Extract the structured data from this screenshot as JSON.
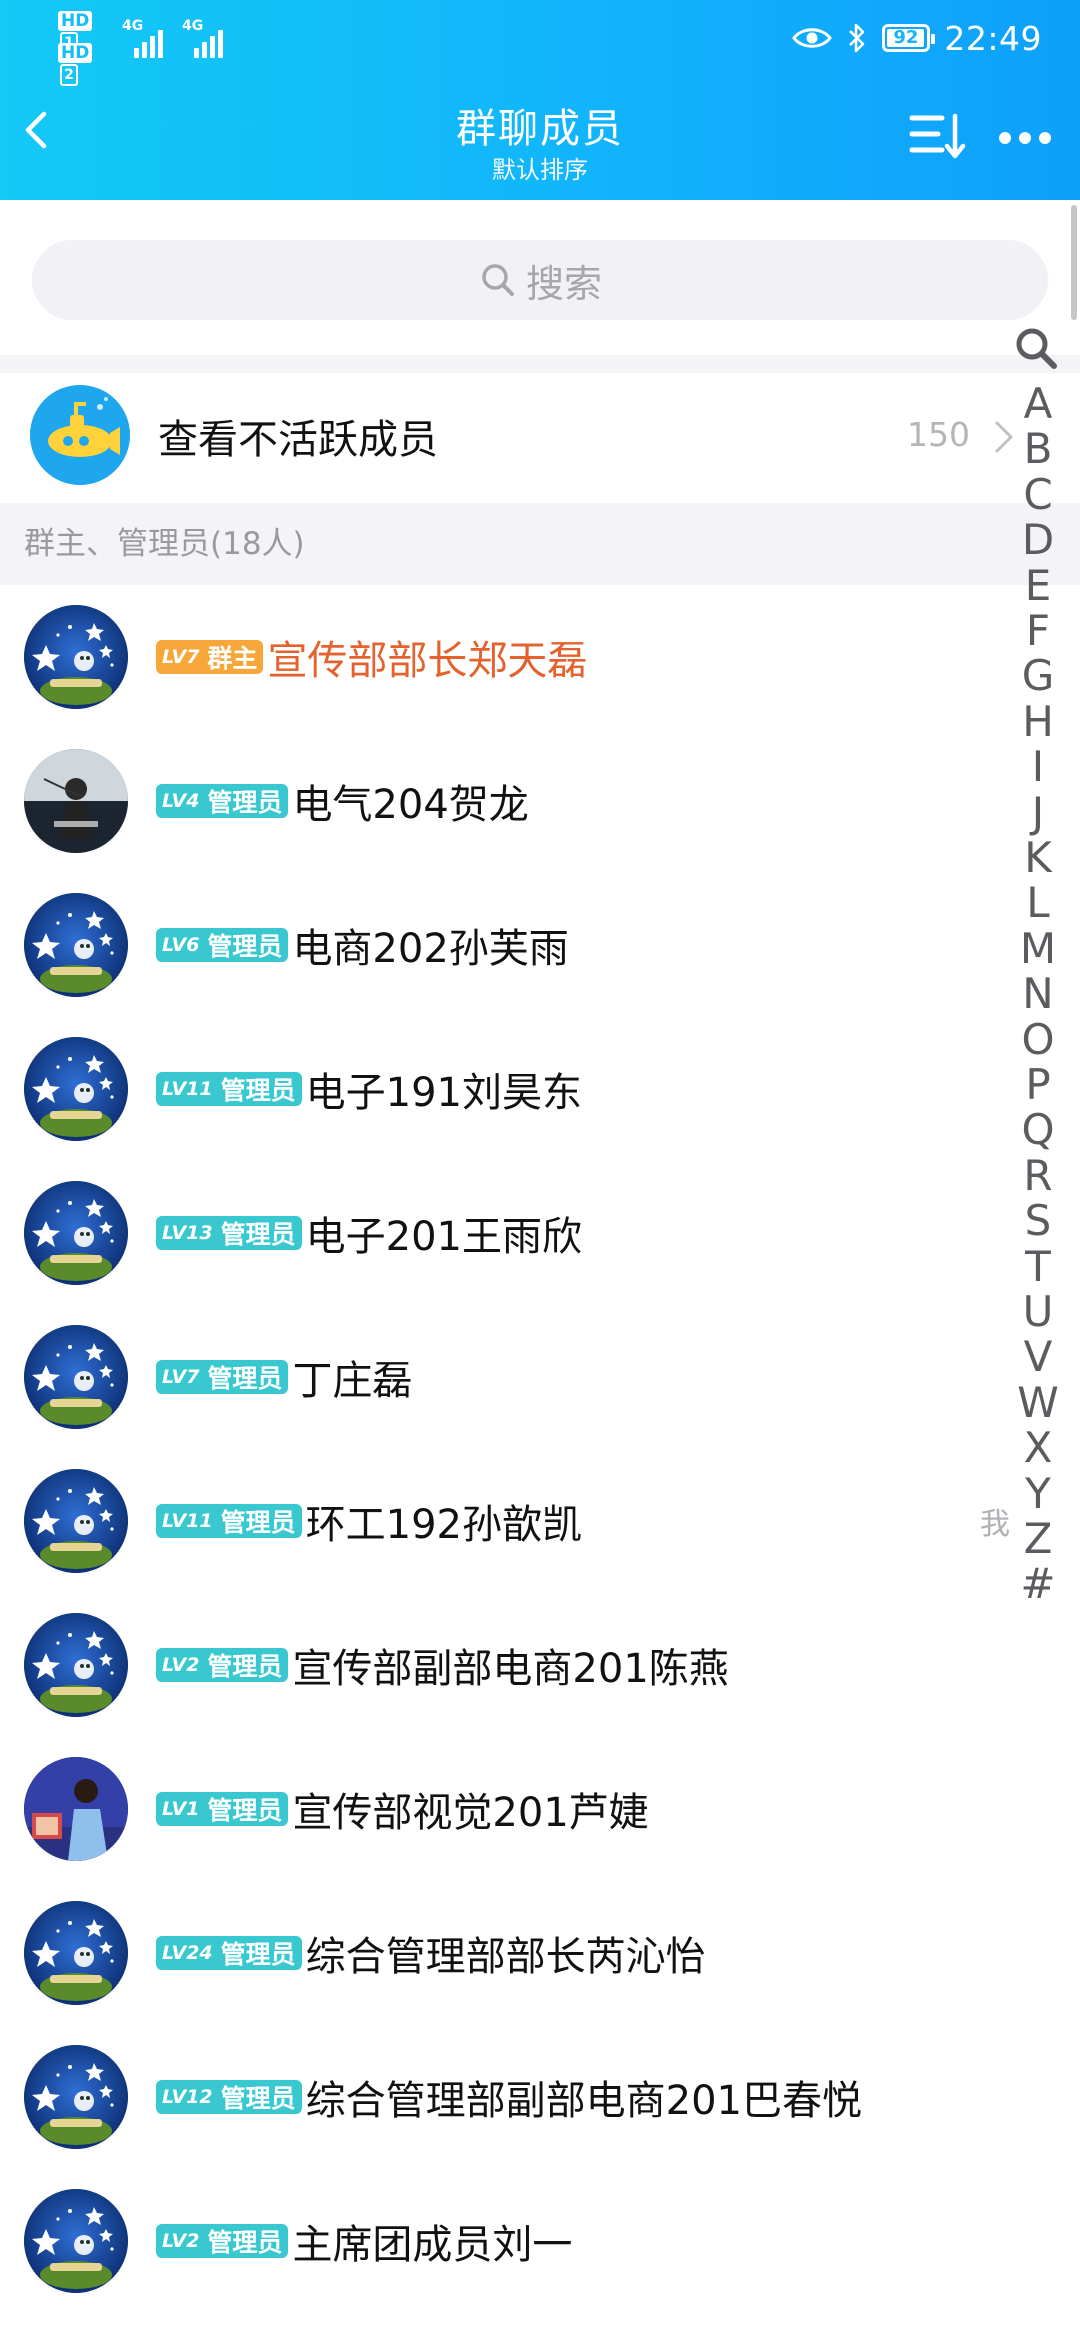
{
  "status_bar": {
    "hd1": "HD",
    "hd1_num": "1",
    "hd2": "HD",
    "hd2_num": "2",
    "net1": "4G",
    "net2": "4G",
    "battery": "92",
    "time": "22:49"
  },
  "header": {
    "title": "群聊成员",
    "subtitle": "默认排序",
    "back_icon": "chevron-left-icon",
    "sort_icon": "sort-icon",
    "more_icon": "more-dots-icon"
  },
  "search": {
    "placeholder": "搜索"
  },
  "inactive": {
    "label": "查看不活跃成员",
    "count": "150"
  },
  "section": {
    "title": "群主、管理员(18人)"
  },
  "members": [
    {
      "level": "LV7",
      "role": "群主",
      "name": "宣传部部长郑天磊",
      "is_owner": true,
      "avatar": "group-logo"
    },
    {
      "level": "LV4",
      "role": "管理员",
      "name": "电气204贺龙",
      "is_owner": false,
      "avatar": "photo-dark"
    },
    {
      "level": "LV6",
      "role": "管理员",
      "name": "电商202孙芙雨",
      "is_owner": false,
      "avatar": "group-logo"
    },
    {
      "level": "LV11",
      "role": "管理员",
      "name": "电子191刘昊东",
      "is_owner": false,
      "avatar": "group-logo"
    },
    {
      "level": "LV13",
      "role": "管理员",
      "name": "电子201王雨欣",
      "is_owner": false,
      "avatar": "group-logo"
    },
    {
      "level": "LV7",
      "role": "管理员",
      "name": "丁庄磊",
      "is_owner": false,
      "avatar": "group-logo"
    },
    {
      "level": "LV11",
      "role": "管理员",
      "name": "环工192孙歆凯",
      "is_owner": false,
      "avatar": "group-logo",
      "me": "我"
    },
    {
      "level": "LV2",
      "role": "管理员",
      "name": "宣传部副部电商201陈燕",
      "is_owner": false,
      "avatar": "group-logo"
    },
    {
      "level": "LV1",
      "role": "管理员",
      "name": "宣传部视觉201芦婕",
      "is_owner": false,
      "avatar": "photo-blue"
    },
    {
      "level": "LV24",
      "role": "管理员",
      "name": "综合管理部部长芮沁怡",
      "is_owner": false,
      "avatar": "group-logo"
    },
    {
      "level": "LV12",
      "role": "管理员",
      "name": "综合管理部副部电商201巴春悦",
      "is_owner": false,
      "avatar": "group-logo"
    },
    {
      "level": "LV2",
      "role": "管理员",
      "name": "主席团成员刘一",
      "is_owner": false,
      "avatar": "group-logo"
    }
  ],
  "index_bar": {
    "search_icon": "search-icon",
    "letters": [
      "A",
      "B",
      "C",
      "D",
      "E",
      "F",
      "G",
      "H",
      "I",
      "J",
      "K",
      "L",
      "M",
      "N",
      "O",
      "P",
      "Q",
      "R",
      "S",
      "T",
      "U",
      "V",
      "W",
      "X",
      "Y",
      "Z",
      "#"
    ]
  },
  "colors": {
    "header_start": "#13c9f6",
    "header_end": "#0ea0fb",
    "admin_badge": "#39c8cf",
    "owner_badge": "#f7a73a",
    "owner_name": "#e4622d"
  }
}
